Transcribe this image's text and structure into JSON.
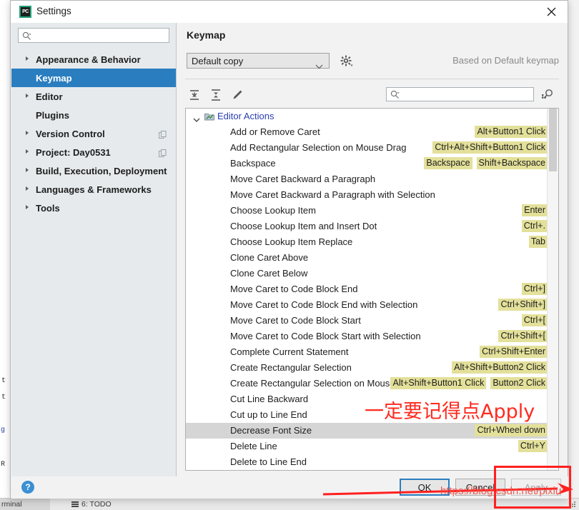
{
  "background_ide": {
    "gutter_fragments": [
      "t",
      "t",
      "g",
      "R"
    ],
    "status_bar": {
      "terminal_label": "rminal",
      "todo_label": "6: TODO"
    }
  },
  "window": {
    "title": "Settings",
    "app_icon": "pycharm-icon",
    "app_icon_text": "PC",
    "close_icon": "close-icon"
  },
  "sidebar": {
    "search": {
      "placeholder": "",
      "value": "",
      "icon": "search-icon"
    },
    "items": [
      {
        "label": "Appearance & Behavior",
        "expandable": true,
        "selected": false,
        "badge": false
      },
      {
        "label": "Keymap",
        "expandable": false,
        "selected": true,
        "badge": false
      },
      {
        "label": "Editor",
        "expandable": true,
        "selected": false,
        "badge": false
      },
      {
        "label": "Plugins",
        "expandable": false,
        "selected": false,
        "badge": false
      },
      {
        "label": "Version Control",
        "expandable": true,
        "selected": false,
        "badge": true
      },
      {
        "label": "Project: Day0531",
        "expandable": true,
        "selected": false,
        "badge": true
      },
      {
        "label": "Build, Execution, Deployment",
        "expandable": true,
        "selected": false,
        "badge": false
      },
      {
        "label": "Languages & Frameworks",
        "expandable": true,
        "selected": false,
        "badge": false
      },
      {
        "label": "Tools",
        "expandable": true,
        "selected": false,
        "badge": false
      }
    ]
  },
  "main": {
    "title": "Keymap",
    "keymap_select": {
      "value": "Default copy",
      "icon": "chevron-down-icon"
    },
    "gear_icon": "gear-icon",
    "based_on": "Based on Default keymap",
    "toolbar": {
      "expand_all_icon": "expand-all-icon",
      "collapse_all_icon": "collapse-all-icon",
      "edit_icon": "pencil-edit-icon",
      "filter": {
        "value": "",
        "placeholder": "",
        "icon": "search-icon"
      },
      "find_by_shortcut_icon": "keyboard-search-icon"
    },
    "tree": {
      "group": {
        "label": "Editor Actions",
        "expanded": true,
        "icon": "editor-actions-folder-icon"
      },
      "rows": [
        {
          "label": "Add or Remove Caret",
          "shortcuts": [
            "Alt+Button1 Click"
          ],
          "selected": false
        },
        {
          "label": "Add Rectangular Selection on Mouse Drag",
          "shortcuts": [
            "Ctrl+Alt+Shift+Button1 Click"
          ],
          "selected": false
        },
        {
          "label": "Backspace",
          "shortcuts": [
            "Backspace",
            "Shift+Backspace"
          ],
          "selected": false
        },
        {
          "label": "Move Caret Backward a Paragraph",
          "shortcuts": [],
          "selected": false
        },
        {
          "label": "Move Caret Backward a Paragraph with Selection",
          "shortcuts": [],
          "selected": false
        },
        {
          "label": "Choose Lookup Item",
          "shortcuts": [
            "Enter"
          ],
          "selected": false
        },
        {
          "label": "Choose Lookup Item and Insert Dot",
          "shortcuts": [
            "Ctrl+."
          ],
          "selected": false
        },
        {
          "label": "Choose Lookup Item Replace",
          "shortcuts": [
            "Tab"
          ],
          "selected": false
        },
        {
          "label": "Clone Caret Above",
          "shortcuts": [],
          "selected": false
        },
        {
          "label": "Clone Caret Below",
          "shortcuts": [],
          "selected": false
        },
        {
          "label": "Move Caret to Code Block End",
          "shortcuts": [
            "Ctrl+]"
          ],
          "selected": false
        },
        {
          "label": "Move Caret to Code Block End with Selection",
          "shortcuts": [
            "Ctrl+Shift+]"
          ],
          "selected": false
        },
        {
          "label": "Move Caret to Code Block Start",
          "shortcuts": [
            "Ctrl+["
          ],
          "selected": false
        },
        {
          "label": "Move Caret to Code Block Start with Selection",
          "shortcuts": [
            "Ctrl+Shift+["
          ],
          "selected": false
        },
        {
          "label": "Complete Current Statement",
          "shortcuts": [
            "Ctrl+Shift+Enter"
          ],
          "selected": false
        },
        {
          "label": "Create Rectangular Selection",
          "shortcuts": [
            "Alt+Shift+Button2 Click"
          ],
          "selected": false
        },
        {
          "label": "Create Rectangular Selection on Mouse Drag",
          "shortcuts": [
            "Alt+Shift+Button1 Click",
            "Button2 Click"
          ],
          "selected": false
        },
        {
          "label": "Cut Line Backward",
          "shortcuts": [],
          "selected": false
        },
        {
          "label": "Cut up to Line End",
          "shortcuts": [],
          "selected": false
        },
        {
          "label": "Decrease Font Size",
          "shortcuts": [
            "Ctrl+Wheel down"
          ],
          "selected": true
        },
        {
          "label": "Delete Line",
          "shortcuts": [
            "Ctrl+Y"
          ],
          "selected": false
        },
        {
          "label": "Delete to Line End",
          "shortcuts": [],
          "selected": false
        }
      ]
    }
  },
  "footer": {
    "help_icon": "help-icon",
    "help_label": "?",
    "ok_label": "OK",
    "cancel_label": "Cancel",
    "apply_label": "Apply"
  },
  "annotations": {
    "note_text": "一定要记得点Apply",
    "watermark": "https://blog.csdn.net/pixiu",
    "highlight_color": "#ff2020"
  }
}
